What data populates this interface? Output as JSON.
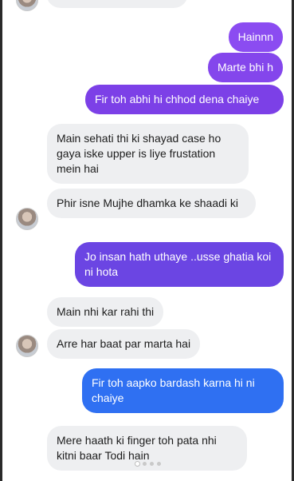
{
  "colors": {
    "outgoing_light": "#8a4cf0",
    "outgoing_mid": "#7a3fe6",
    "outgoing_blue": "#2f6ff2",
    "incoming_bg": "#eeeff1"
  },
  "messages": [
    {
      "id": "m1",
      "direction": "out",
      "text": "Hainnn"
    },
    {
      "id": "m2",
      "direction": "out",
      "text": "Marte bhi h"
    },
    {
      "id": "m3",
      "direction": "out",
      "text": "Fir toh abhi hi chhod dena chaiye"
    },
    {
      "id": "m4",
      "direction": "in",
      "text": "Main sehati thi ki shayad case ho gaya iske upper is liye frustation mein hai"
    },
    {
      "id": "m5",
      "direction": "in",
      "text": "Phir isne Mujhe dhamka ke shaadi ki"
    },
    {
      "id": "m6",
      "direction": "out",
      "text": "Jo insan hath uthaye ..usse ghatia koi ni hota"
    },
    {
      "id": "m7",
      "direction": "in",
      "text": "Main nhi kar rahi thi"
    },
    {
      "id": "m8",
      "direction": "in",
      "text": "Arre har baat par marta hai"
    },
    {
      "id": "m9",
      "direction": "out",
      "text": "Fir toh aapko bardash karna hi ni chaiye"
    },
    {
      "id": "m10",
      "direction": "in",
      "text": "Mere haath ki finger toh pata nhi kitni baar Todi hain"
    }
  ],
  "pagination": {
    "total": 4,
    "current": 1
  }
}
